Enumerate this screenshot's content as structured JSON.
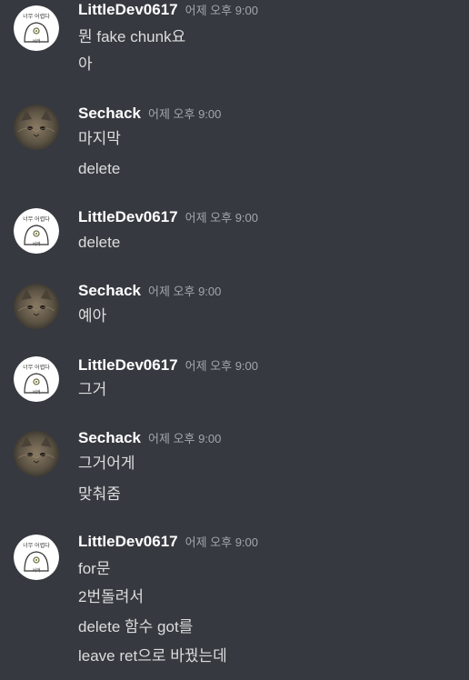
{
  "users": {
    "littledev": "LittleDev0617",
    "sechack": "Sechack"
  },
  "avatar_icons": {
    "littledev": "ghost-doodle-avatar-icon",
    "sechack": "cat-photo-avatar-icon"
  },
  "avatar_text": {
    "top": "너무 어렵다",
    "bottom": "서러"
  },
  "colors": {
    "background": "#36393f",
    "username": "#ffffff",
    "message_text": "#dcddde",
    "timestamp": "#a3a6aa"
  },
  "messages": [
    {
      "author": "LittleDev0617",
      "timestamp": "어제 오후 9:00",
      "lines": [
        "뭔 fake chunk요",
        "아"
      ]
    },
    {
      "author": "Sechack",
      "timestamp": "어제 오후 9:00",
      "lines": [
        "마지막",
        "delete"
      ]
    },
    {
      "author": "LittleDev0617",
      "timestamp": "어제 오후 9:00",
      "lines": [
        "delete"
      ]
    },
    {
      "author": "Sechack",
      "timestamp": "어제 오후 9:00",
      "lines": [
        "예아"
      ]
    },
    {
      "author": "LittleDev0617",
      "timestamp": "어제 오후 9:00",
      "lines": [
        "그거"
      ]
    },
    {
      "author": "Sechack",
      "timestamp": "어제 오후 9:00",
      "lines": [
        "그거어게",
        "맞춰줌"
      ]
    },
    {
      "author": "LittleDev0617",
      "timestamp": "어제 오후 9:00",
      "lines": [
        "for문",
        "2번돌려서",
        "delete 함수 got를",
        "leave ret으로 바꿨는데"
      ]
    }
  ]
}
